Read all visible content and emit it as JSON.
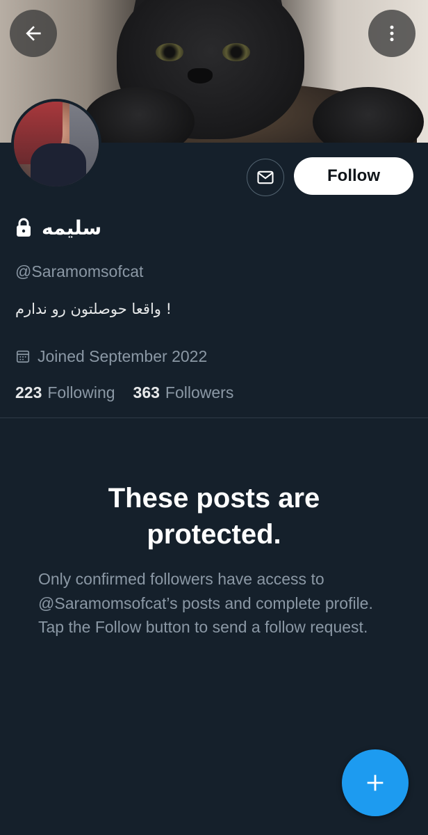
{
  "header": {
    "back_icon": "arrow-left-icon",
    "more_icon": "more-vertical-icon"
  },
  "profile": {
    "display_name": "سليمه",
    "lock_icon": "lock-icon",
    "handle": "@Saramomsofcat",
    "bio": "واقعا حوصلتون رو ندارم !",
    "joined": "Joined September 2022",
    "calendar_icon": "calendar-icon",
    "following_count": "223",
    "following_label": "Following",
    "followers_count": "363",
    "followers_label": "Followers"
  },
  "actions": {
    "message_icon": "mail-icon",
    "follow_label": "Follow"
  },
  "protected": {
    "title": "These posts are protected.",
    "body": "Only confirmed followers have access to @Saramomsofcat’s posts and complete profile. Tap the Follow button to send a follow request."
  },
  "fab": {
    "icon": "plus-icon"
  },
  "colors": {
    "background": "#15202b",
    "accent": "#1d9bf0",
    "secondary_text": "#8b98a5"
  }
}
